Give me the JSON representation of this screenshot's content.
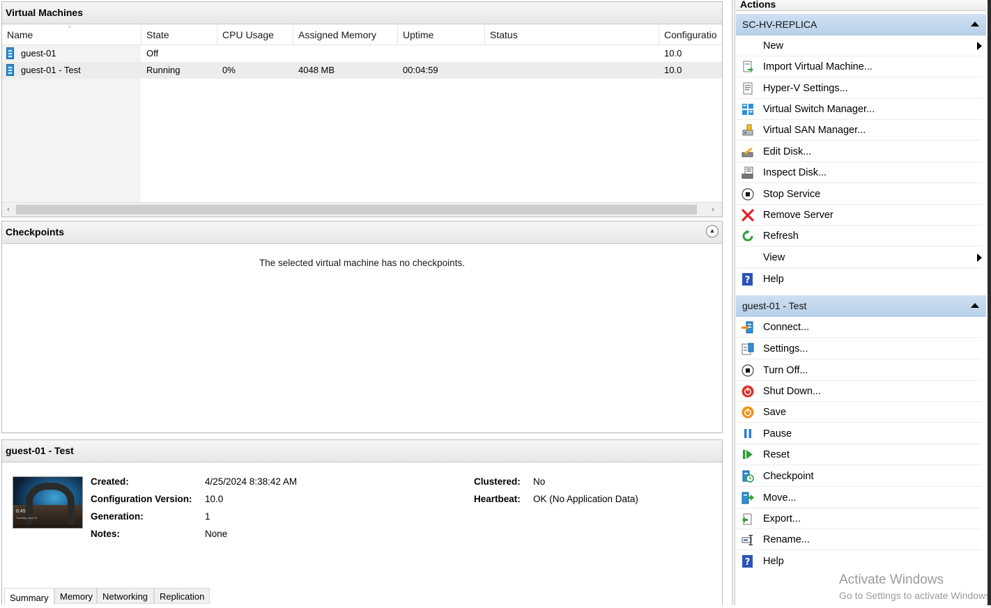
{
  "vm_pane": {
    "title": "Virtual Machines",
    "columns": [
      "Name",
      "State",
      "CPU Usage",
      "Assigned Memory",
      "Uptime",
      "Status",
      "Configuratio"
    ],
    "rows": [
      {
        "name": "guest-01",
        "state": "Off",
        "cpu": "",
        "memory": "",
        "uptime": "",
        "status": "",
        "config": "10.0"
      },
      {
        "name": "guest-01 - Test",
        "state": "Running",
        "cpu": "0%",
        "memory": "4048 MB",
        "uptime": "00:04:59",
        "status": "",
        "config": "10.0"
      }
    ],
    "scroll_left": "‹",
    "scroll_right": "›"
  },
  "checkpoints": {
    "title": "Checkpoints",
    "message": "The selected virtual machine has no checkpoints."
  },
  "details": {
    "title": "guest-01 - Test",
    "thumb_time": "8:45",
    "thumb_subtitle": "Tuesday, April 25",
    "created_label": "Created:",
    "created_value": "4/25/2024 8:38:42 AM",
    "config_label": "Configuration Version:",
    "config_value": "10.0",
    "generation_label": "Generation:",
    "generation_value": "1",
    "notes_label": "Notes:",
    "notes_value": "None",
    "clustered_label": "Clustered:",
    "clustered_value": "No",
    "heartbeat_label": "Heartbeat:",
    "heartbeat_value": "OK (No Application Data)",
    "tabs": [
      "Summary",
      "Memory",
      "Networking",
      "Replication"
    ],
    "active_tab": "Summary"
  },
  "actions": {
    "title": "Actions",
    "server_group": "SC-HV-REPLICA",
    "server_items": [
      "New",
      "Import Virtual Machine...",
      "Hyper-V Settings...",
      "Virtual Switch Manager...",
      "Virtual SAN Manager...",
      "Edit Disk...",
      "Inspect Disk...",
      "Stop Service",
      "Remove Server",
      "Refresh",
      "View",
      "Help"
    ],
    "vm_group": "guest-01 - Test",
    "vm_items": [
      "Connect...",
      "Settings...",
      "Turn Off...",
      "Shut Down...",
      "Save",
      "Pause",
      "Reset",
      "Checkpoint",
      "Move...",
      "Export...",
      "Rename...",
      "Help"
    ]
  },
  "watermark": {
    "line1": "Activate Windows",
    "line2": "Go to Settings to activate Windows."
  },
  "colors": {
    "group_header": "#c4d9ee",
    "selected_row": "#ececec",
    "remove_red": "#e02020",
    "refresh_green": "#2e9e3e",
    "shutdown_red": "#d8302a",
    "save_orange": "#f0901a",
    "pause_blue": "#2a7bd6"
  }
}
